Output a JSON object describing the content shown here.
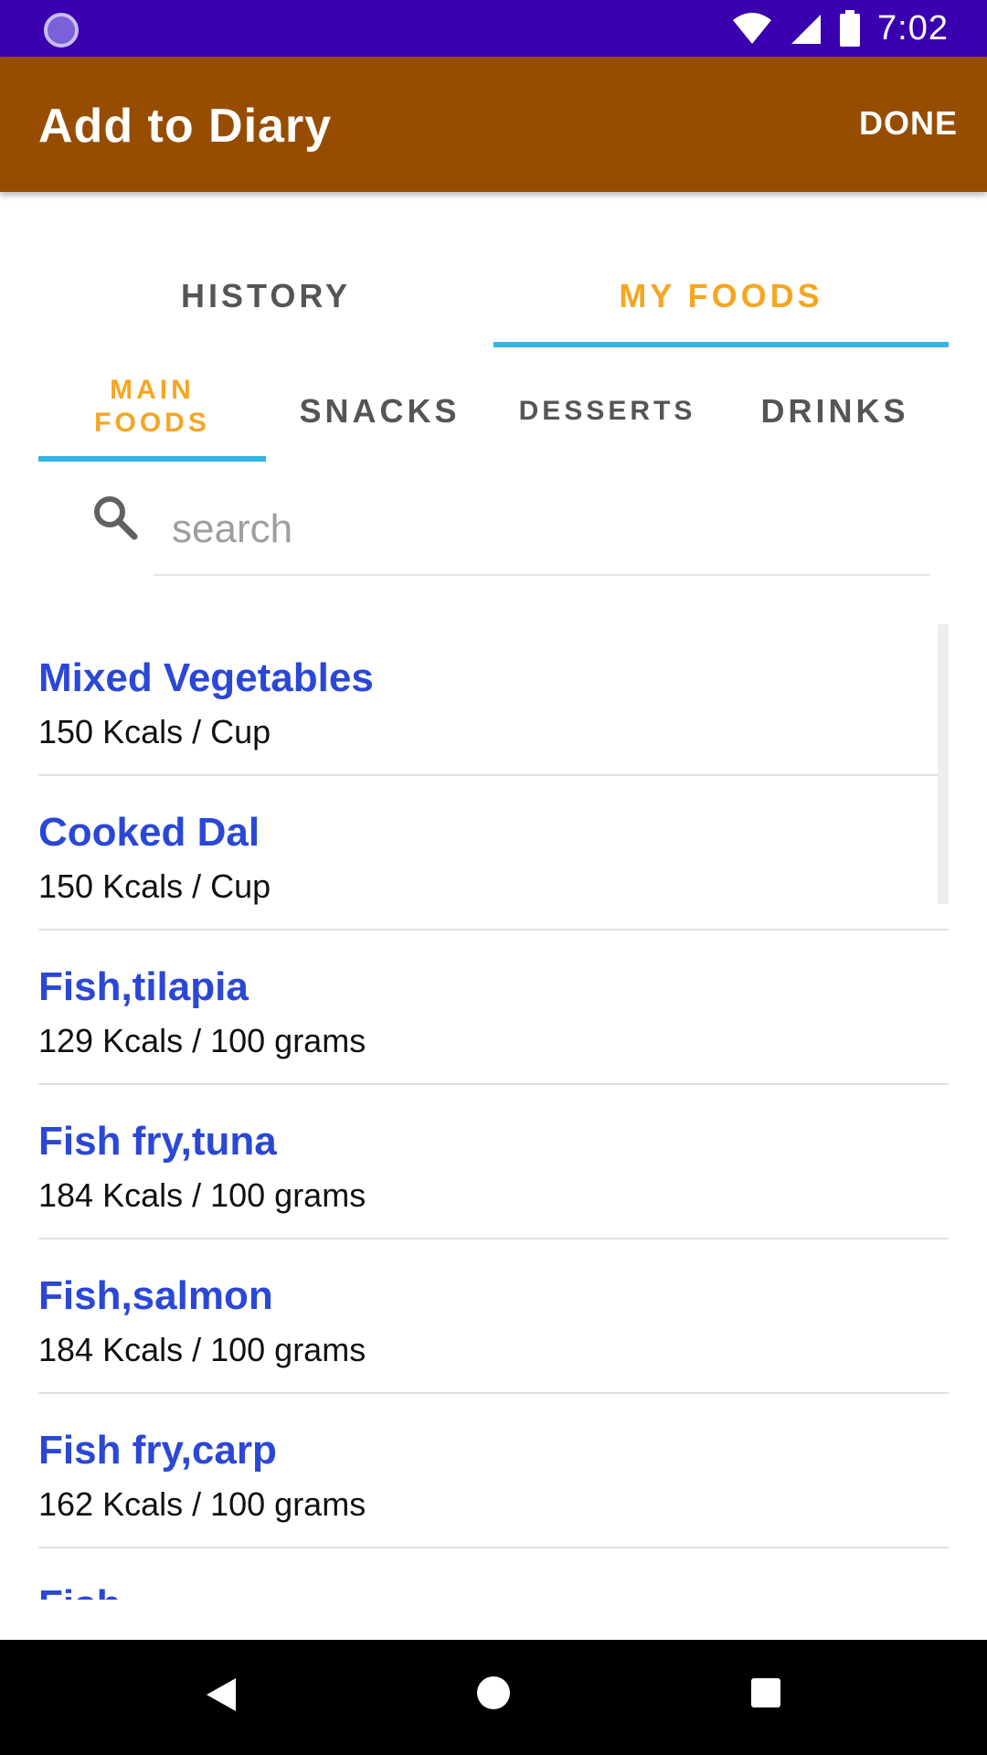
{
  "status_bar": {
    "time": "7:02"
  },
  "app_bar": {
    "title": "Add to Diary",
    "done_label": "DONE"
  },
  "top_tabs": [
    {
      "label": "HISTORY",
      "selected": false
    },
    {
      "label": "MY FOODS",
      "selected": true
    }
  ],
  "sub_tabs": [
    {
      "label": "MAIN\nFOODS",
      "selected": true
    },
    {
      "label": "SNACKS",
      "selected": false
    },
    {
      "label": "DESSERTS",
      "selected": false
    },
    {
      "label": "DRINKS",
      "selected": false
    }
  ],
  "search": {
    "placeholder": "search",
    "value": ""
  },
  "foods": [
    {
      "name": "Mixed Vegetables",
      "kcal": "150 Kcals / Cup"
    },
    {
      "name": "Cooked Dal",
      "kcal": "150 Kcals / Cup"
    },
    {
      "name": "Fish,tilapia",
      "kcal": "129 Kcals / 100 grams"
    },
    {
      "name": "Fish fry,tuna",
      "kcal": "184 Kcals / 100 grams"
    },
    {
      "name": "Fish,salmon",
      "kcal": "184 Kcals / 100 grams"
    },
    {
      "name": "Fish fry,carp",
      "kcal": "162 Kcals / 100 grams"
    },
    {
      "name": "Fish",
      "kcal": ""
    }
  ],
  "colors": {
    "status_bar": "#3a00b0",
    "app_bar": "#974d00",
    "accent_orange": "#f5a623",
    "tab_indicator": "#33b5e5",
    "food_name": "#2a47d6"
  },
  "icons": {
    "status_left": "loading-indicator-icon",
    "wifi": "wifi-icon",
    "signal": "signal-icon",
    "battery": "battery-icon",
    "search": "search-icon",
    "nav_back": "back-triangle-icon",
    "nav_home": "home-circle-icon",
    "nav_recents": "recents-square-icon"
  }
}
